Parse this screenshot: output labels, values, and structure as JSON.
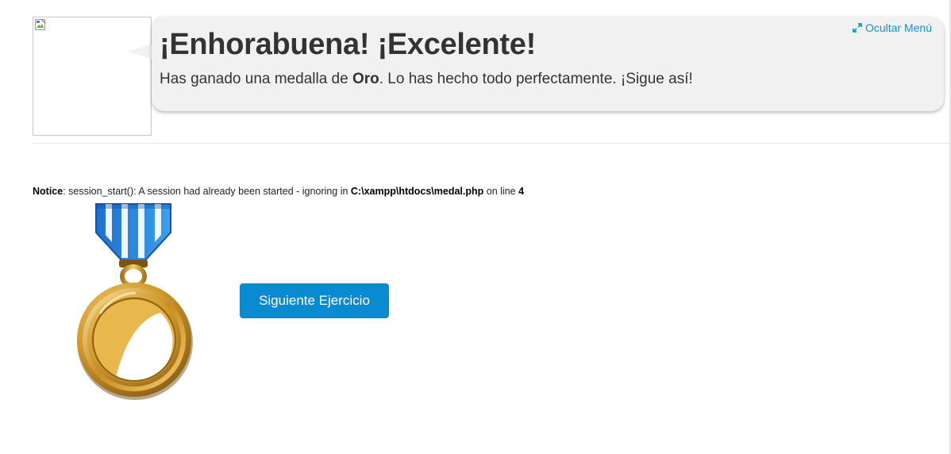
{
  "header": {
    "title": "¡Enhorabuena! ¡Excelente!",
    "message_prefix": "Has ganado una medalla de ",
    "medal_name": "Oro",
    "message_suffix": ". Lo has hecho todo perfectamente. ¡Sigue así!",
    "hide_menu_label": "Ocultar Menú"
  },
  "notice": {
    "label": "Notice",
    "text": ": session_start(): A session had already been started - ignoring in ",
    "file": "C:\\xampp\\htdocs\\medal.php",
    "line_text": " on line ",
    "line_number": "4"
  },
  "actions": {
    "next_label": "Siguiente Ejercicio"
  },
  "colors": {
    "accent": "#0a8ad0",
    "link": "#1b8fcf",
    "bubble_bg": "#f1f1f1",
    "medal_gold": "#d6a63c",
    "ribbon_blue": "#2f8fe0"
  },
  "icons": {
    "avatar": "broken-image-icon",
    "hide_menu": "expand-arrows-icon",
    "medal": "gold-medal-icon"
  }
}
